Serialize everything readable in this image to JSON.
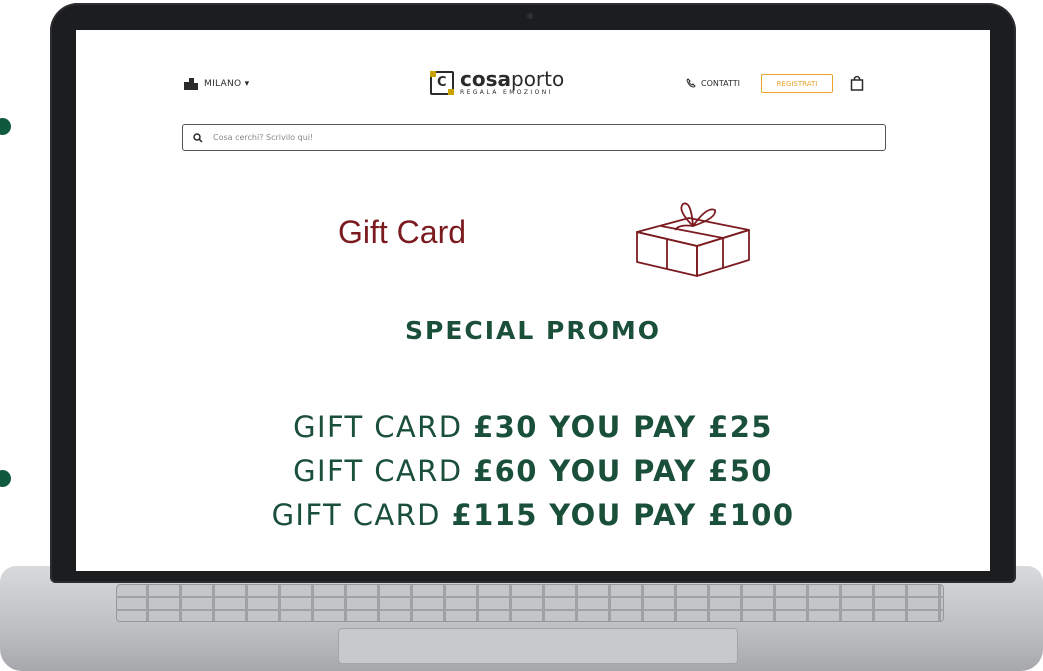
{
  "header": {
    "city": "MILANO",
    "city_caret": "▾",
    "logo_letter": "C",
    "logo_name_bold": "cosa",
    "logo_name_rest": "porto",
    "logo_tagline": "REGALA EMOZIONI",
    "contacts_label": "CONTATTI",
    "register_label": "REGISTRATI"
  },
  "search": {
    "placeholder": "Cosa cerchi? Scrivilo qui!"
  },
  "hero": {
    "title": "Gift Card",
    "promo_heading": "SPECIAL PROMO",
    "offers": [
      {
        "prefix": "GIFT CARD",
        "deal": "£30 YOU PAY £25"
      },
      {
        "prefix": "GIFT CARD",
        "deal": "£60 YOU PAY £50"
      },
      {
        "prefix": "GIFT CARD",
        "deal": "£115 YOU PAY £100"
      }
    ]
  },
  "colors": {
    "brand_green": "#1a4f3a",
    "gift_red": "#7b1b20",
    "register_orange": "#e8a42d",
    "logo_gold": "#c9a100"
  },
  "icons": [
    "city-building-icon",
    "phone-icon",
    "shopping-bag-icon",
    "search-icon",
    "gift-box-icon"
  ]
}
